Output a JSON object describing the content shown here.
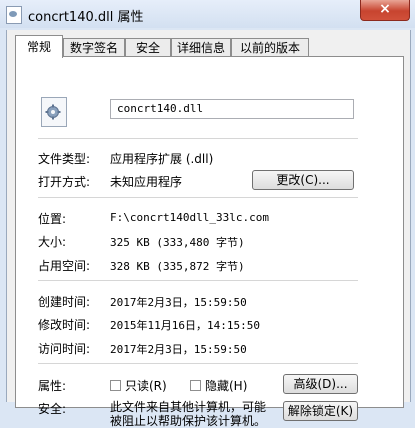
{
  "window": {
    "title": "concrt140.dll 属性",
    "close_glyph": "×"
  },
  "tabs": [
    {
      "label": "常规"
    },
    {
      "label": "数字签名"
    },
    {
      "label": "安全"
    },
    {
      "label": "详细信息"
    },
    {
      "label": "以前的版本"
    }
  ],
  "general": {
    "filename": "concrt140.dll",
    "file_type_label": "文件类型:",
    "file_type_value": "应用程序扩展 (.dll)",
    "open_with_label": "打开方式:",
    "open_with_value": "未知应用程序",
    "change_button": "更改(C)...",
    "location_label": "位置:",
    "location_value": "F:\\concrt140dll_33lc.com",
    "size_label": "大小:",
    "size_value": "325 KB (333,480 字节)",
    "size_on_disk_label": "占用空间:",
    "size_on_disk_value": "328 KB (335,872 字节)",
    "created_label": "创建时间:",
    "created_value": "2017年2月3日，15:59:50",
    "modified_label": "修改时间:",
    "modified_value": "2015年11月16日，14:15:50",
    "accessed_label": "访问时间:",
    "accessed_value": "2017年2月3日，15:59:50",
    "attributes_label": "属性:",
    "readonly_label": "只读(R)",
    "hidden_label": "隐藏(H)",
    "advanced_button": "高级(D)...",
    "security_label": "安全:",
    "security_text": "此文件来自其他计算机，可能被阻止以帮助保护该计算机。",
    "unblock_button": "解除锁定(K)"
  },
  "colors": {
    "close_button": "#c7442f",
    "title_bar": "#dbe6f4"
  }
}
